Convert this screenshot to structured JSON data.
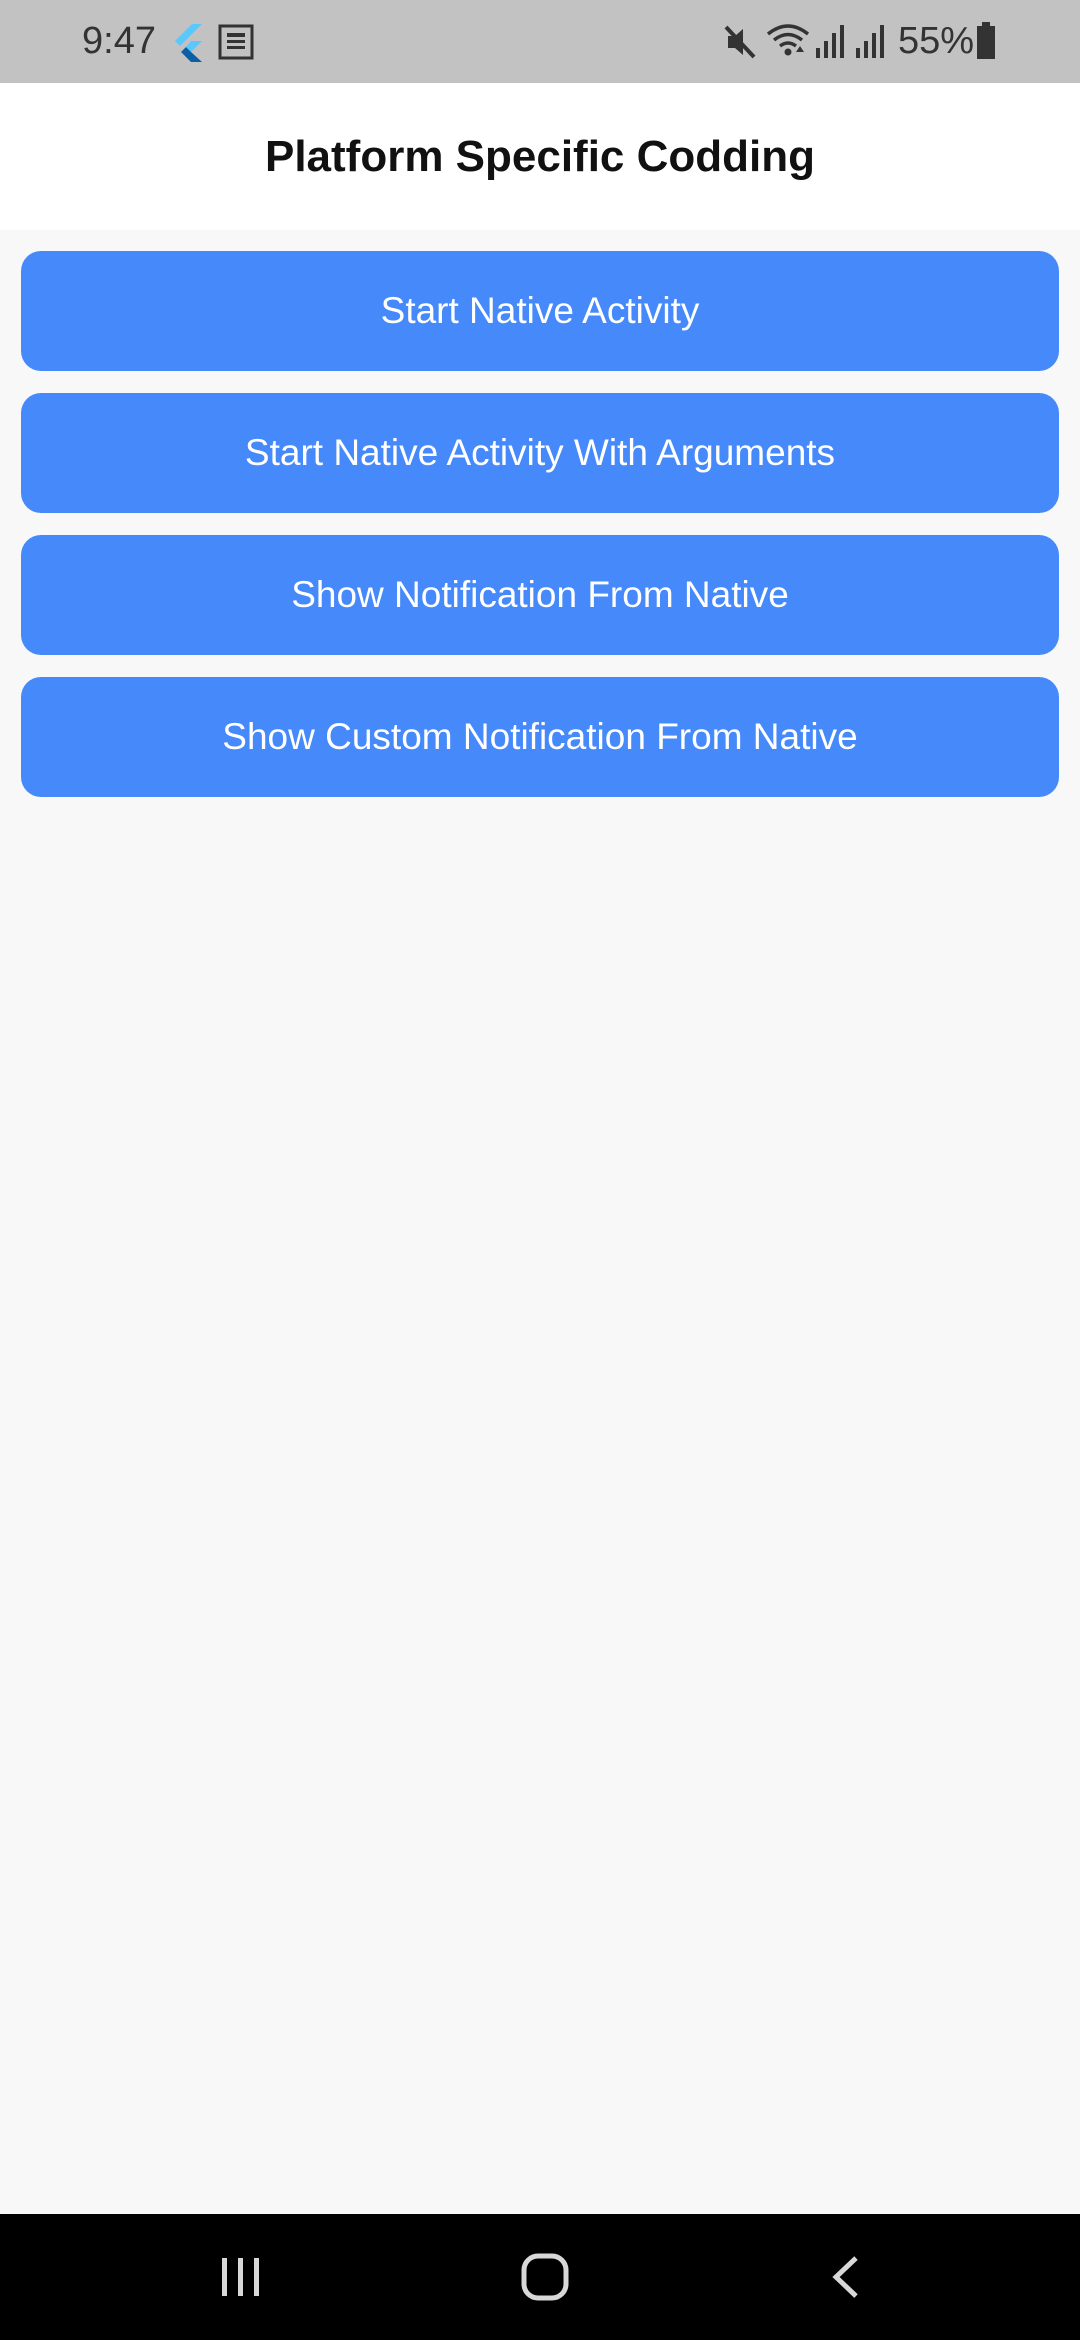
{
  "status_bar": {
    "time": "9:47",
    "battery": "55%",
    "icons": [
      "flutter-icon",
      "news-icon",
      "mute-icon",
      "wifi-icon",
      "signal-icon",
      "signal-icon",
      "battery-icon"
    ]
  },
  "app_bar": {
    "title": "Platform Specific Codding"
  },
  "buttons": [
    {
      "label": "Start Native Activity"
    },
    {
      "label": "Start Native Activity With Arguments"
    },
    {
      "label": "Show Notification From Native"
    },
    {
      "label": "Show Custom Notification From Native"
    }
  ],
  "nav_bar": {
    "icons": [
      "recents-icon",
      "home-icon",
      "back-icon"
    ]
  },
  "colors": {
    "accent": "#4589fb",
    "status_bar": "#c2c2c2",
    "background": "#f8f8f8"
  }
}
